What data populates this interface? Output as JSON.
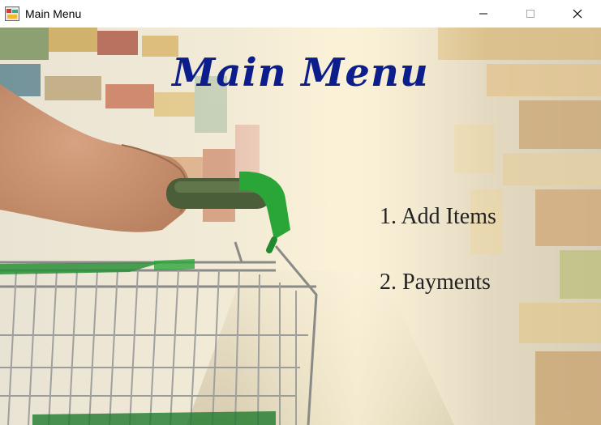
{
  "window": {
    "title": "Main Menu",
    "controls": {
      "minimize": "minimize",
      "maximize": "maximize",
      "close": "close"
    }
  },
  "main": {
    "heading": "Main Menu",
    "menu_items": [
      {
        "label": "1. Add Items"
      },
      {
        "label": "2. Payments"
      }
    ]
  },
  "colors": {
    "heading": "#0b1e8c",
    "menu_text": "#222222"
  }
}
